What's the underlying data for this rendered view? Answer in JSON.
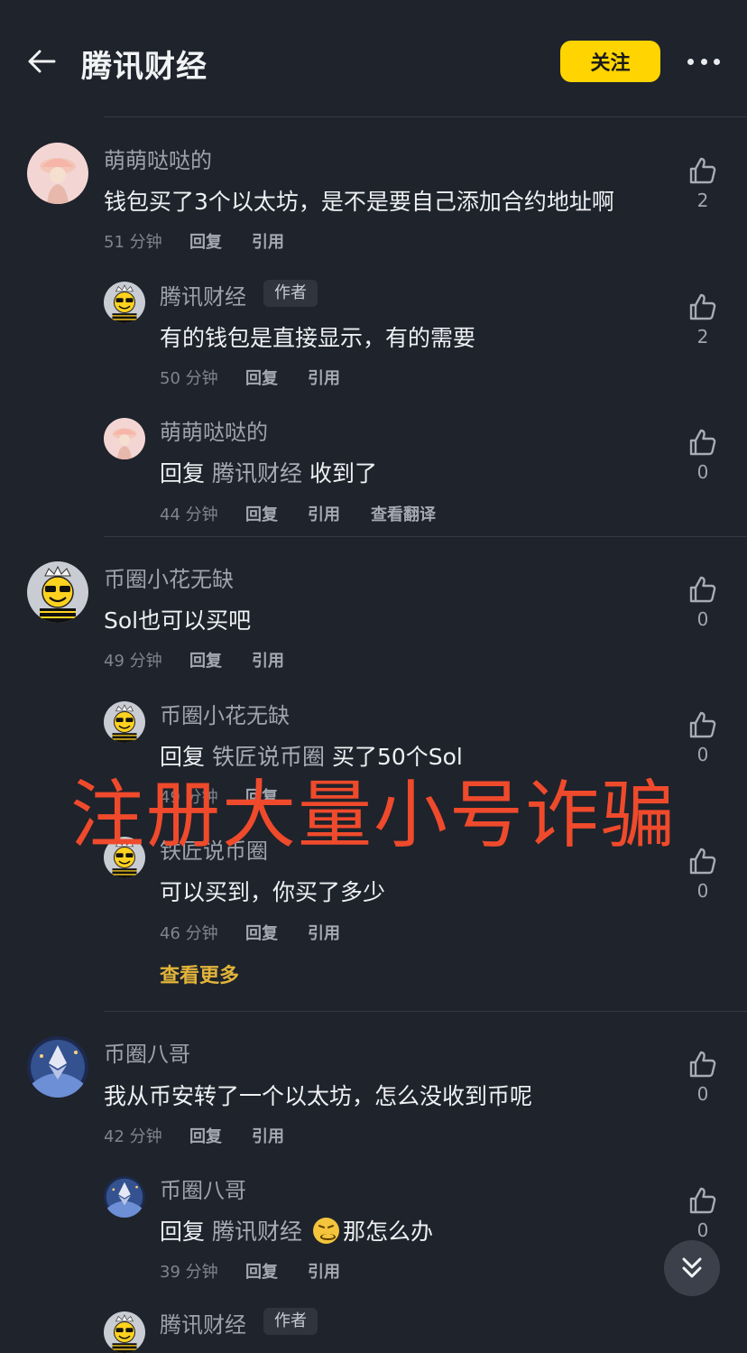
{
  "header": {
    "title": "腾讯财经",
    "follow_label": "关注"
  },
  "overlay_text": "注册大量小号诈骗",
  "see_more_label": "查看更多",
  "actions": {
    "reply": "回复",
    "quote": "引用",
    "translate": "查看翻译"
  },
  "comments": [
    {
      "name": "萌萌哒哒的",
      "text": "钱包买了3个以太坊，是不是要自己添加合约地址啊",
      "time": "51 分钟",
      "likes": "2"
    },
    {
      "name": "腾讯财经",
      "tag": "作者",
      "text": "有的钱包是直接显示，有的需要",
      "time": "50 分钟",
      "likes": "2"
    },
    {
      "name": "萌萌哒哒的",
      "reply_prefix": "回复",
      "reply_to": "腾讯财经",
      "text": "收到了",
      "time": "44 分钟",
      "likes": "0"
    },
    {
      "name": "币圈小花无缺",
      "text": "Sol也可以买吧",
      "time": "49 分钟",
      "likes": "0"
    },
    {
      "name": "币圈小花无缺",
      "reply_prefix": "回复",
      "reply_to": "铁匠说币圈",
      "text": "买了50个Sol",
      "time": "49 分钟",
      "likes": "0"
    },
    {
      "name": "铁匠说币圈",
      "text": "可以买到，你买了多少",
      "time": "46 分钟",
      "likes": "0"
    },
    {
      "name": "币圈八哥",
      "text": "我从币安转了一个以太坊，怎么没收到币呢",
      "time": "42 分钟",
      "likes": "0"
    },
    {
      "name": "币圈八哥",
      "reply_prefix": "回复",
      "reply_to": "腾讯财经",
      "text": "那怎么办",
      "emoji": "persevering-face-emoji",
      "time": "39 分钟",
      "likes": "0"
    },
    {
      "name": "腾讯财经",
      "tag": "作者"
    }
  ]
}
